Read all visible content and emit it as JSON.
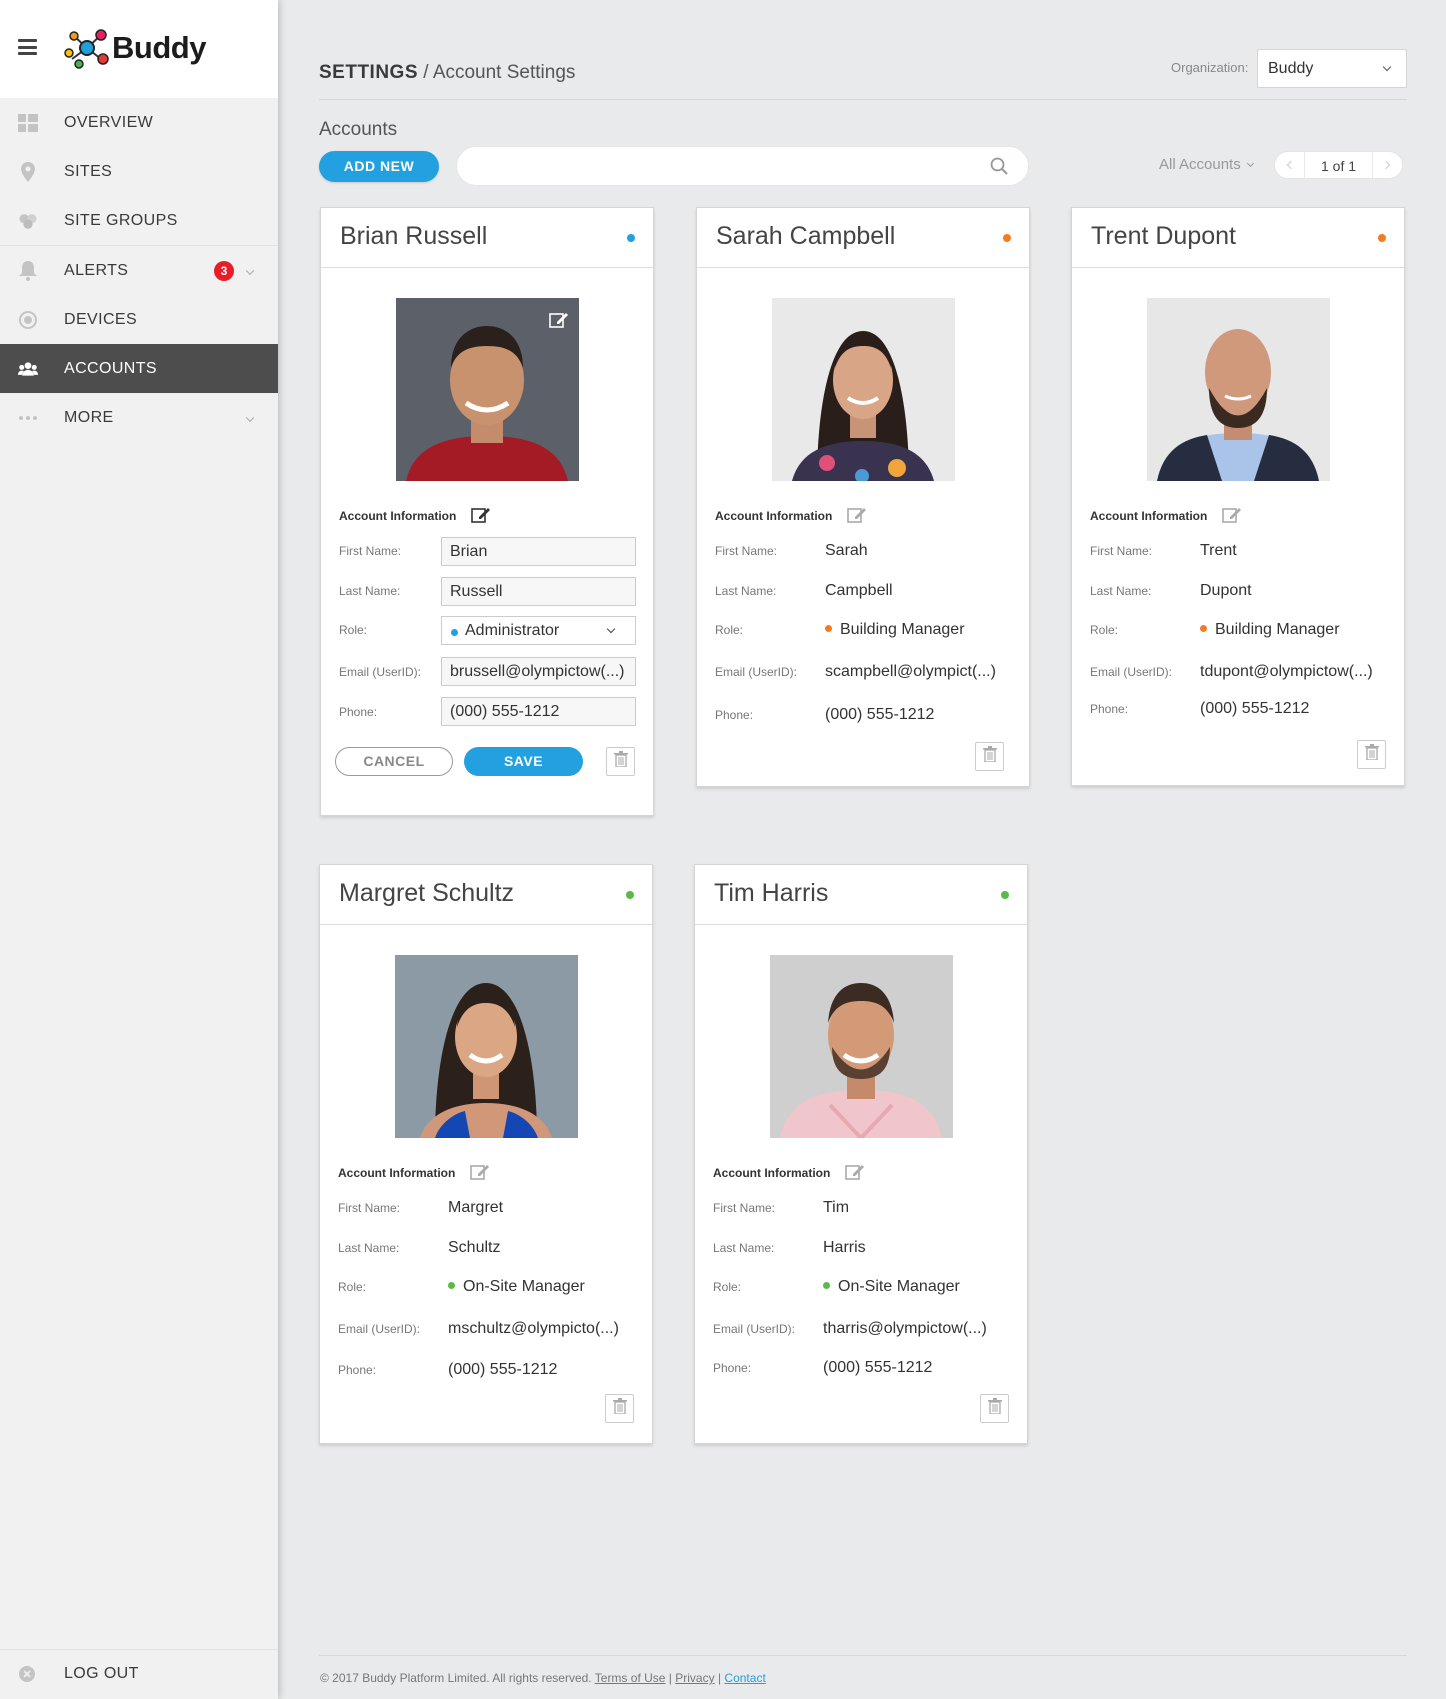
{
  "app": {
    "name": "Buddy"
  },
  "sidebar": {
    "items": [
      {
        "label": "OVERVIEW",
        "icon": "grid-icon"
      },
      {
        "label": "SITES",
        "icon": "map-pin-icon"
      },
      {
        "label": "SITE GROUPS",
        "icon": "site-groups-icon"
      },
      {
        "label": "ALERTS",
        "icon": "bell-icon",
        "badge": "3"
      },
      {
        "label": "DEVICES",
        "icon": "device-icon"
      },
      {
        "label": "ACCOUNTS",
        "icon": "users-icon",
        "active": true
      },
      {
        "label": "MORE",
        "icon": "more-icon"
      }
    ],
    "logout": "LOG OUT"
  },
  "header": {
    "section": "SETTINGS",
    "separator": "/",
    "page": "Account Settings",
    "org_label": "Organization:",
    "org_value": "Buddy"
  },
  "toolbar": {
    "title": "Accounts",
    "add_new": "ADD NEW",
    "search_placeholder": "",
    "filter": "All Accounts",
    "pagination": "1 of 1"
  },
  "labels": {
    "account_info": "Account Information",
    "first_name": "First Name:",
    "last_name": "Last Name:",
    "role": "Role:",
    "email": "Email (UserID):",
    "phone": "Phone:",
    "cancel": "CANCEL",
    "save": "SAVE"
  },
  "accounts": [
    {
      "full_name": "Brian Russell",
      "first": "Brian",
      "last": "Russell",
      "role": "Administrator",
      "email": "brussell@olympictow(...)",
      "phone": "(000) 555-1212",
      "status_color": "#22a0e0",
      "editing": true
    },
    {
      "full_name": "Sarah Campbell",
      "first": "Sarah",
      "last": "Campbell",
      "role": "Building Manager",
      "email": "scampbell@olympict(...)",
      "phone": "(000) 555-1212",
      "status_color": "#f47c20"
    },
    {
      "full_name": "Trent Dupont",
      "first": "Trent",
      "last": "Dupont",
      "role": "Building Manager",
      "email": "tdupont@olympictow(...)",
      "phone": "(000) 555-1212",
      "status_color": "#f47c20"
    },
    {
      "full_name": "Margret Schultz",
      "first": "Margret",
      "last": "Schultz",
      "role": "On-Site Manager",
      "email": "mschultz@olympicto(...)",
      "phone": "(000) 555-1212",
      "status_color": "#5ab947"
    },
    {
      "full_name": "Tim Harris",
      "first": "Tim",
      "last": "Harris",
      "role": "On-Site Manager",
      "email": "tharris@olympictow(...)",
      "phone": "(000) 555-1212",
      "status_color": "#5ab947"
    }
  ],
  "footer": {
    "copyright": "© 2017 Buddy Platform Limited. All rights reserved.",
    "terms": "Terms of Use",
    "privacy": "Privacy",
    "contact": "Contact",
    "divider": "|"
  }
}
